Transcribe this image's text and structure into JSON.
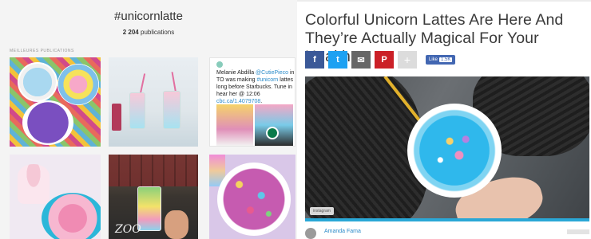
{
  "instagram": {
    "hashtag": "#unicornlatte",
    "post_count": "2 204",
    "post_count_suffix": "publications",
    "section_label": "MEILLEURES PUBLICATIONS",
    "tweet": {
      "text_pre": "Melanie Abdilla ",
      "mention": "@CutiePieco",
      "text_mid": " in TO was making ",
      "hashtag": "#unicorn",
      "text_post": " lattes long before Starbucks. Tune in hear her @ 12:06 ",
      "link": "cbc.ca/1.4079708",
      "link_suffix": "."
    },
    "post5_overlay": "ZOO"
  },
  "article": {
    "title": "Colorful Unicorn Lattes Are Here And They’re Actually Magical For Your Health",
    "share": {
      "facebook_icon": "f",
      "twitter_icon": "t",
      "email_icon": "✉",
      "pinterest_icon": "P",
      "plus_icon": "+",
      "like_label": "Like",
      "like_count": "1.5K"
    },
    "image_credit": "instagram",
    "author": "Amanda Fama"
  },
  "colors": {
    "facebook": "#3b5998",
    "twitter": "#1da1f2",
    "email": "#666666",
    "pinterest": "#cb2027",
    "accent_bar": "#2aa7d6"
  }
}
